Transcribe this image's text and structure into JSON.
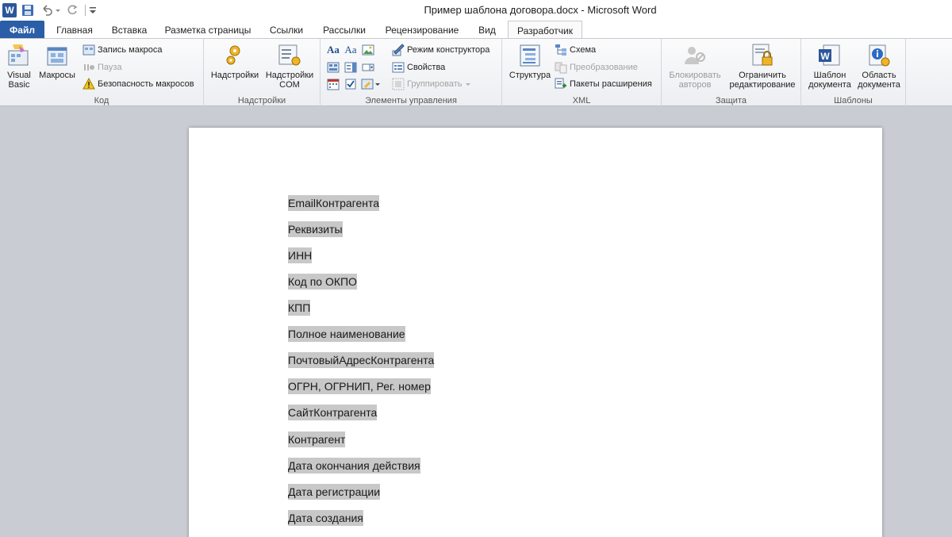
{
  "window": {
    "title": "Пример шаблона договора.docx  -  Microsoft Word",
    "app_logo_letter": "W"
  },
  "tabs": [
    {
      "label": "Файл"
    },
    {
      "label": "Главная"
    },
    {
      "label": "Вставка"
    },
    {
      "label": "Разметка страницы"
    },
    {
      "label": "Ссылки"
    },
    {
      "label": "Рассылки"
    },
    {
      "label": "Рецензирование"
    },
    {
      "label": "Вид"
    },
    {
      "label": "Разработчик"
    }
  ],
  "ribbon": {
    "code": {
      "label": "Код",
      "visual_basic": "Visual Basic",
      "macros": "Макросы",
      "record_macro": "Запись макроса",
      "pause": "Пауза",
      "macro_security": "Безопасность макросов"
    },
    "addins": {
      "label": "Надстройки",
      "addins_btn": "Надстройки",
      "com_addins_line1": "Надстройки",
      "com_addins_line2": "COM"
    },
    "controls": {
      "label": "Элементы управления",
      "design_mode": "Режим конструктора",
      "properties": "Свойства",
      "group": "Группировать"
    },
    "xml": {
      "label": "XML",
      "structure": "Структура",
      "schema": "Схема",
      "transform": "Преобразование",
      "expansion_packs": "Пакеты расширения"
    },
    "protect": {
      "label": "Защита",
      "block_authors_line1": "Блокировать",
      "block_authors_line2": "авторов",
      "restrict_line1": "Ограничить",
      "restrict_line2": "редактирование"
    },
    "templates": {
      "label": "Шаблоны",
      "doc_template_line1": "Шаблон",
      "doc_template_line2": "документа",
      "doc_panel_line1": "Область",
      "doc_panel_line2": "документа"
    }
  },
  "document": {
    "fields": [
      "EmailКонтрагента",
      "Реквизиты",
      "ИНН",
      "Код по ОКПО",
      "КПП",
      "Полное наименование",
      "ПочтовыйАдресКонтрагента",
      "ОГРН, ОГРНИП, Рег. номер",
      "СайтКонтрагента",
      "Контрагент",
      "Дата окончания действия",
      "Дата регистрации",
      "Дата создания"
    ]
  },
  "colors": {
    "file_tab": "#2a5ea7",
    "field_highlight": "#c8c8c8",
    "workspace": "#c9cdd3"
  }
}
